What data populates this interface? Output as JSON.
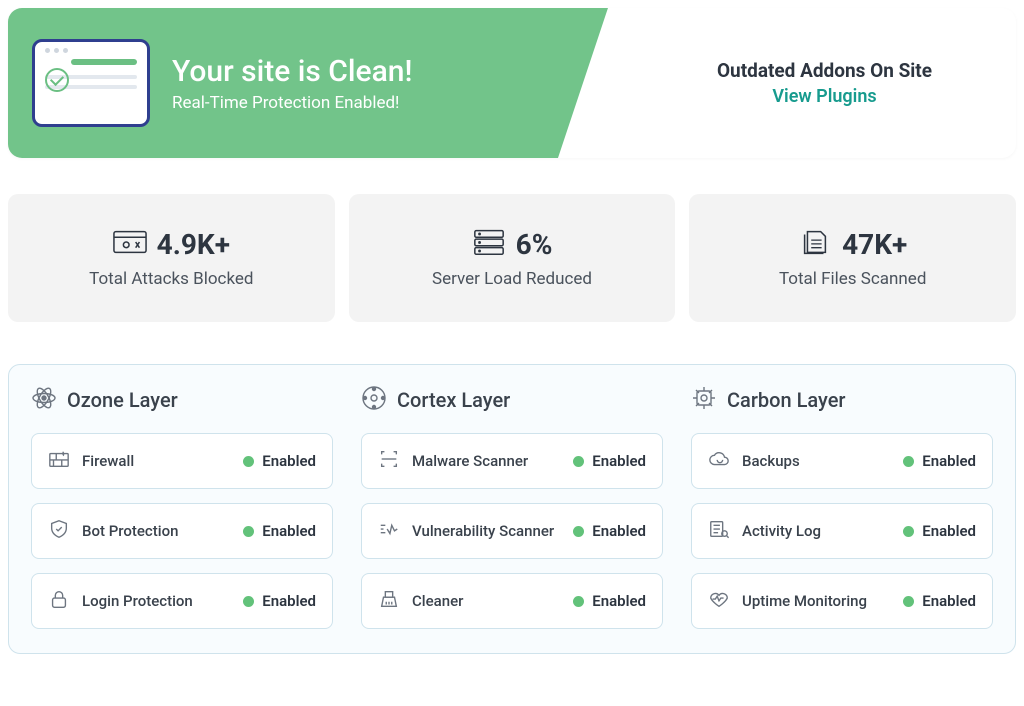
{
  "hero": {
    "title": "Your site is Clean!",
    "subtitle": "Real-Time Protection Enabled!",
    "addons_title": "Outdated Addons On Site",
    "addons_link": "View Plugins"
  },
  "stats": [
    {
      "icon": "attacks",
      "value": "4.9K+",
      "label": "Total Attacks Blocked"
    },
    {
      "icon": "server",
      "value": "6%",
      "label": "Server Load Reduced"
    },
    {
      "icon": "files",
      "value": "47K+",
      "label": "Total Files Scanned"
    }
  ],
  "layers": [
    {
      "icon": "atom",
      "title": "Ozone Layer",
      "features": [
        {
          "icon": "firewall",
          "name": "Firewall",
          "status": "Enabled"
        },
        {
          "icon": "shield",
          "name": "Bot Protection",
          "status": "Enabled"
        },
        {
          "icon": "lock",
          "name": "Login Protection",
          "status": "Enabled"
        }
      ]
    },
    {
      "icon": "aperture",
      "title": "Cortex Layer",
      "features": [
        {
          "icon": "scan",
          "name": "Malware Scanner",
          "status": "Enabled"
        },
        {
          "icon": "vuln",
          "name": "Vulnerability Scanner",
          "status": "Enabled"
        },
        {
          "icon": "broom",
          "name": "Cleaner",
          "status": "Enabled"
        }
      ]
    },
    {
      "icon": "cpu",
      "title": "Carbon Layer",
      "features": [
        {
          "icon": "cloud",
          "name": "Backups",
          "status": "Enabled"
        },
        {
          "icon": "log",
          "name": "Activity Log",
          "status": "Enabled"
        },
        {
          "icon": "heart",
          "name": "Uptime Monitoring",
          "status": "Enabled"
        }
      ]
    }
  ]
}
